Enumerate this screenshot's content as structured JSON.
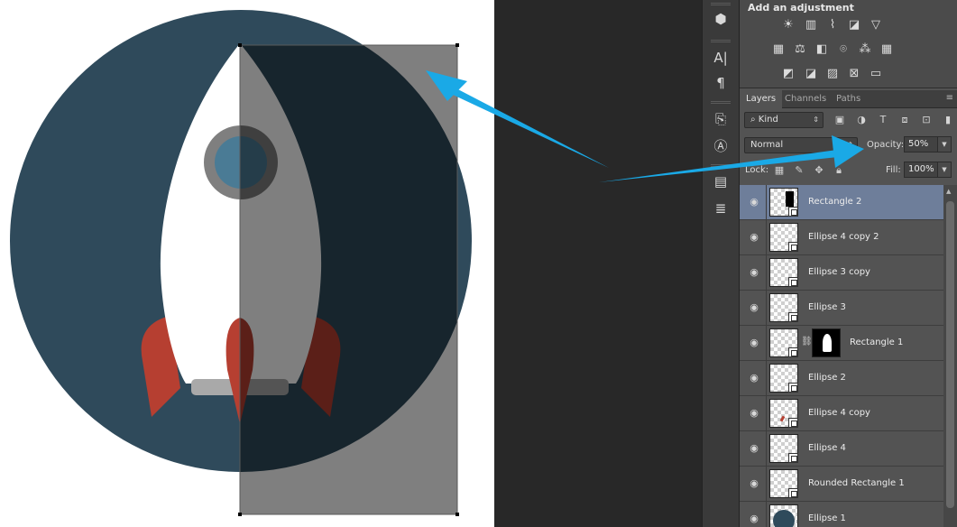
{
  "canvas": {
    "colors": {
      "circle": "#2f4a5b",
      "rocket_body": "#ffffff",
      "fin": "#b63f31",
      "window_ring": "#7f7f7f",
      "window": "#4a7b95",
      "nozzle": "#a9a9a9",
      "overlay": "#000000"
    },
    "overlay_opacity": 0.5
  },
  "tools": [
    "3d-object-icon",
    "character-icon",
    "paragraph-icon",
    "clone-source-icon",
    "character-styles-icon",
    "notes-icon",
    "paragraph-styles-icon"
  ],
  "adjustments": {
    "title": "Add an adjustment",
    "icons_row1": [
      "brightness-icon",
      "levels-icon",
      "curves-icon",
      "exposure-icon",
      "triangle-down-icon"
    ],
    "icons_row2": [
      "vibrance-icon",
      "color-balance-icon",
      "black-white-icon",
      "photo-filter-icon",
      "channel-mixer-icon",
      "color-lookup-icon"
    ],
    "icons_row3": [
      "invert-icon",
      "posterize-icon",
      "threshold-icon",
      "selective-color-icon",
      "gradient-map-icon"
    ]
  },
  "panel": {
    "tabs": [
      {
        "label": "Layers",
        "active": true
      },
      {
        "label": "Channels",
        "active": false
      },
      {
        "label": "Paths",
        "active": false
      }
    ],
    "filter": {
      "label": "Kind",
      "icons": [
        "image-filter-icon",
        "adjustment-filter-icon",
        "type-filter-icon",
        "shape-filter-icon",
        "smart-object-filter-icon",
        "filter-toggle-icon"
      ]
    },
    "blend_mode": "Normal",
    "opacity_label": "Opacity:",
    "opacity_value": "50%",
    "lock_label": "Lock:",
    "fill_label": "Fill:",
    "fill_value": "100%"
  },
  "layers": [
    {
      "name": "Rectangle 2",
      "selected": true,
      "thumb": "rect"
    },
    {
      "name": "Ellipse 4 copy 2",
      "selected": false,
      "thumb": "empty"
    },
    {
      "name": "Ellipse 3 copy",
      "selected": false,
      "thumb": "empty"
    },
    {
      "name": "Ellipse 3",
      "selected": false,
      "thumb": "empty"
    },
    {
      "name": "Rectangle 1",
      "selected": false,
      "thumb": "mask"
    },
    {
      "name": "Ellipse 2",
      "selected": false,
      "thumb": "empty"
    },
    {
      "name": "Ellipse 4 copy",
      "selected": false,
      "thumb": "empty"
    },
    {
      "name": "Ellipse 4",
      "selected": false,
      "thumb": "empty"
    },
    {
      "name": "Rounded Rectangle 1",
      "selected": false,
      "thumb": "empty"
    },
    {
      "name": "Ellipse 1",
      "selected": false,
      "thumb": "circle"
    }
  ],
  "annotation": {
    "arrow_color": "#1aa9e6"
  }
}
